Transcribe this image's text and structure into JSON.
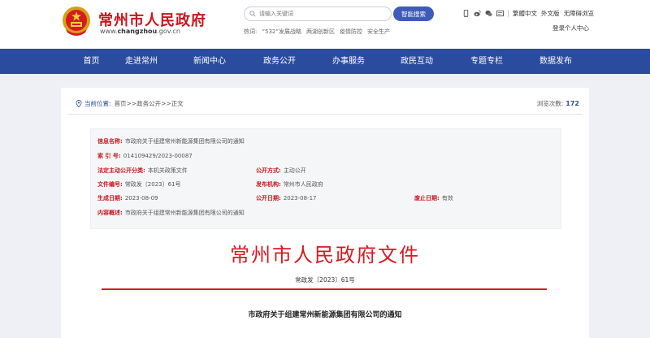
{
  "header": {
    "title": "常州市人民政府",
    "url_prefix": "www.",
    "url_domain": "changzhou",
    "url_suffix": ".gov.cn",
    "search_placeholder": "请输入关键词",
    "search_button": "智能搜索",
    "hot_label": "热词:",
    "hot_words": [
      "“532”发展战略",
      "两湖创新区",
      "疫情防控",
      "安全生产"
    ],
    "tools": {
      "lang": "繁體中文",
      "foreign": "外文版",
      "accessible": "无障碍浏览"
    },
    "login": "登录个人中心"
  },
  "nav": {
    "items": [
      "首页",
      "走进常州",
      "新闻中心",
      "政务公开",
      "办事服务",
      "政民互动",
      "专题专栏",
      "数据发布"
    ]
  },
  "breadcrumb": {
    "label": "当前位置:",
    "items": [
      "首页",
      "政务公开",
      "正文"
    ],
    "sep": " >> "
  },
  "views": {
    "label": "浏览次数:",
    "count": "172"
  },
  "info": {
    "name_k": "信息名称:",
    "name_v": "市政府关于组建常州新能源集团有限公司的通知",
    "index_k": "索 引 号:",
    "index_v": "014109429/2023-00087",
    "cat_k": "法定主动公开分类:",
    "cat_v": "本机关政策文件",
    "mode_k": "公开方式:",
    "mode_v": "主动公开",
    "docno_k": "文件编号:",
    "docno_v": "常政发〔2023〕61号",
    "org_k": "发布机构:",
    "org_v": "常州市人民政府",
    "gen_k": "生成日期:",
    "gen_v": "2023-08-09",
    "pub_k": "公开日期:",
    "pub_v": "2023-08-17",
    "end_k": "废止日期:",
    "end_v": "有效",
    "summary_k": "内容概述:",
    "summary_v": "市政府关于组建常州新能源集团有限公司的通知"
  },
  "document": {
    "title": "常州市人民政府文件",
    "number": "常政发〔2023〕61号",
    "notice_title": "市政府关于组建常州新能源集团有限公司的通知"
  },
  "colors": {
    "brand_red": "#c8161d",
    "nav_blue": "#2b4b9f",
    "search_blue": "#3c5cb8"
  },
  "icons": [
    "emblem-icon",
    "search-icon",
    "mobile-icon",
    "weibo-icon",
    "wechat-icon",
    "message-icon",
    "location-icon"
  ]
}
